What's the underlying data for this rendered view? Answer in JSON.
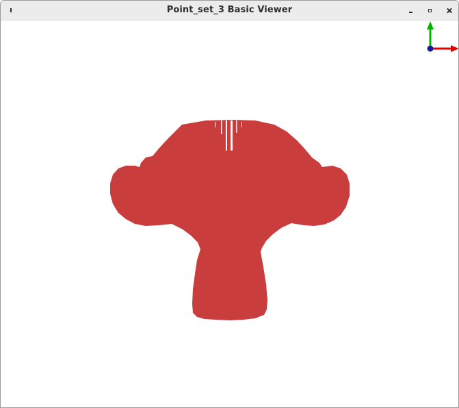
{
  "window": {
    "title": "Point_set_3 Basic Viewer"
  },
  "viewer": {
    "point_color": "#c93d3d",
    "background_color": "#ffffff",
    "axis_colors": {
      "x": "#e00000",
      "y": "#00b400",
      "z": "#1a1aa0"
    }
  }
}
